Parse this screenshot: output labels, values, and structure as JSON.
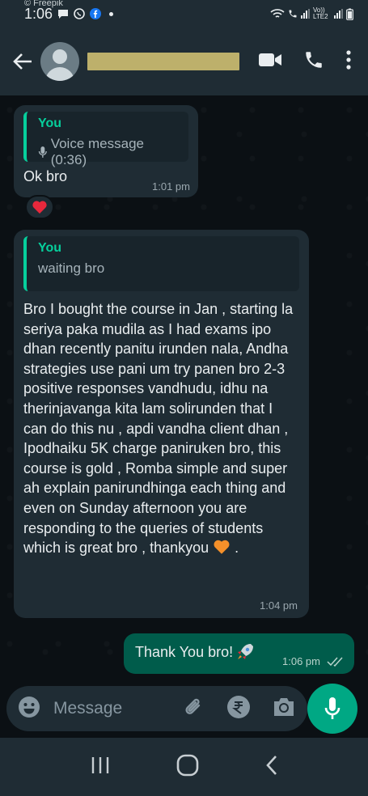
{
  "status_bar": {
    "time": "1:06",
    "watermark": "© Freepik",
    "network_label": "Vo)) LTE2"
  },
  "header": {
    "contact_name": ""
  },
  "messages": [
    {
      "direction": "in",
      "quote_author": "You",
      "quote_text": "Voice message (0:36)",
      "text": "Ok bro",
      "time": "1:01 pm",
      "reaction": "heart"
    },
    {
      "direction": "in",
      "quote_author": "You",
      "quote_text": "waiting bro",
      "text": "Bro I bought the course in Jan , starting la seriya paka mudila as I had exams ipo dhan recently panitu irunden nala, Andha strategies use pani um try panen bro 2-3 positive responses vandhudu, idhu na therinjavanga kita lam solirunden that I can do this nu , apdi vandha client dhan , Ipodhaiku 5K charge paniruken bro, this course is gold , Romba simple and super ah explain panirundhinga each thing and even on Sunday afternoon you are responding to the queries of students which is great bro , thankyou",
      "text_end": ".",
      "time": "1:04 pm"
    },
    {
      "direction": "out",
      "text": "Thank You bro!",
      "time": "1:06 pm"
    }
  ],
  "composer": {
    "placeholder": "Message"
  },
  "colors": {
    "header_bg": "#1f2c34",
    "chat_bg": "#0b1014",
    "incoming_bubble": "#1f2c34",
    "outgoing_bubble": "#005c4b",
    "accent": "#00a884",
    "quote_accent": "#06cf9c",
    "redacted_name": "#bdb06b"
  }
}
